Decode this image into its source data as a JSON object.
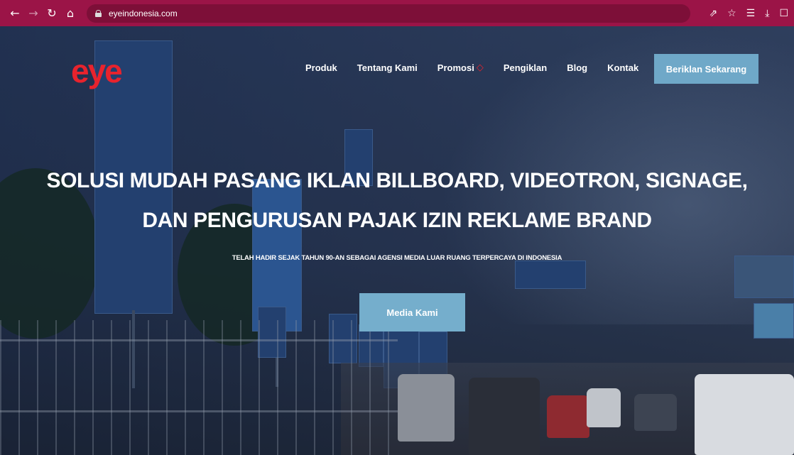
{
  "browser": {
    "url": "eyeindonesia.com",
    "icons": [
      "back-arrow-icon",
      "forward-arrow-icon",
      "reload-icon",
      "home-icon",
      "lock-icon",
      "share-icon",
      "star-icon",
      "reading-list-icon",
      "download-icon",
      "window-icon"
    ]
  },
  "site": {
    "logo_text": "eye",
    "brand_color": "#e8232d",
    "accent_color": "#6fa8c8"
  },
  "nav": {
    "items": [
      {
        "label": "Produk"
      },
      {
        "label": "Tentang Kami"
      },
      {
        "label": "Promosi"
      },
      {
        "label": "Pengiklan"
      },
      {
        "label": "Blog"
      },
      {
        "label": "Kontak"
      }
    ],
    "cta_label": "Beriklan Sekarang"
  },
  "hero": {
    "headline_line1": "SOLUSI MUDAH PASANG IKLAN BILLBOARD, VIDEOTRON, SIGNAGE,",
    "headline_line2": "DAN PENGURUSAN PAJAK IZIN REKLAME BRAND",
    "subheadline": "TELAH HADIR SEJAK TAHUN 90-AN SEBAGAI AGENSI MEDIA LUAR RUANG TERPERCAYA DI INDONESIA",
    "button_label": "Media Kami"
  }
}
